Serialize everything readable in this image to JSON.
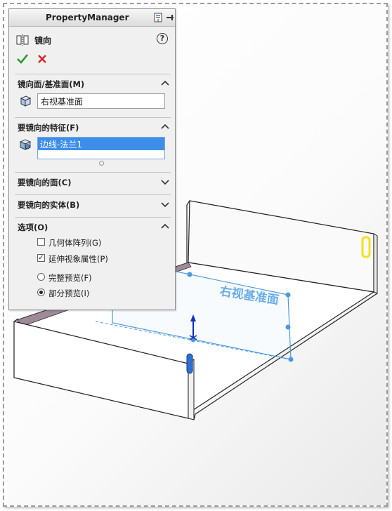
{
  "panel": {
    "title": "PropertyManager",
    "feature_name": "镜向",
    "help_glyph": "?",
    "ok_glyph": "✔",
    "cancel_glyph": "✕"
  },
  "sections": {
    "mirror_plane": {
      "title": "镜向面/基准面(M)",
      "value": "右视基准面"
    },
    "features": {
      "title": "要镜向的特征(F)",
      "items": [
        "边线-法兰1"
      ]
    },
    "faces": {
      "title": "要镜向的面(C)"
    },
    "bodies": {
      "title": "要镜向的实体(B)"
    },
    "options": {
      "title": "选项(O)",
      "geometry_pattern": {
        "label": "几何体阵列(G)",
        "checked": false
      },
      "propagate_visual": {
        "label": "延伸视象属性(P)",
        "checked": true
      },
      "full_preview": {
        "label": "完整预览(F)",
        "selected": false
      },
      "partial_preview": {
        "label": "部分预览(I)",
        "selected": true
      }
    }
  },
  "viewport": {
    "plane_label": "右视基准面"
  },
  "colors": {
    "accent": "#3d8ee8",
    "plane": "#5aa8e8",
    "ok": "#2e9a2e",
    "cancel": "#d42020",
    "highlight": "#f5e81a"
  },
  "icons": {
    "mirror": "mirror-feature-icon",
    "pin": "pushpin-icon",
    "plane": "plane-cube-icon",
    "feature": "feature-list-icon",
    "chevron_up": "chevron-up-icon",
    "chevron_down": "chevron-down-icon"
  }
}
